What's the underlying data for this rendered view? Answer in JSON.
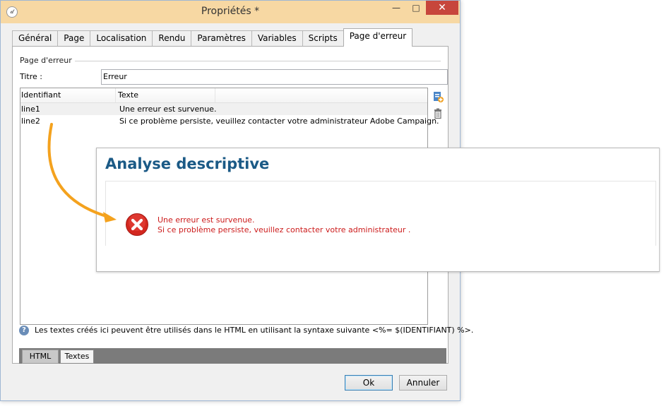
{
  "window": {
    "title": "Propriétés *",
    "app_icon": "𝒹"
  },
  "tabs": [
    "Général",
    "Page",
    "Localisation",
    "Rendu",
    "Paramètres",
    "Variables",
    "Scripts",
    "Page d'erreur"
  ],
  "section": {
    "title": "Page d'erreur"
  },
  "form": {
    "titre_label": "Titre :",
    "titre_value": "Erreur"
  },
  "grid": {
    "headers": [
      "Identifiant",
      "Texte"
    ],
    "rows": [
      {
        "id": "line1",
        "text": "Une erreur est survenue."
      },
      {
        "id": "line2",
        "text": "Si ce problème persiste, veuillez contacter votre administrateur Adobe Campaign."
      }
    ]
  },
  "hint": "Les textes créés ici peuvent être utilisés dans le HTML en utilisant la syntaxe suivante <%= $(IDENTIFIANT) %>.",
  "bottom_tabs": {
    "html": "HTML",
    "textes": "Textes"
  },
  "buttons": {
    "ok": "Ok",
    "cancel": "Annuler"
  },
  "overlay": {
    "title": "Analyse descriptive",
    "line1": "Une erreur est survenue.",
    "line2": "Si ce problème persiste, veuillez contacter votre administrateur ."
  },
  "colors": {
    "overlay_title": "#1b5a86",
    "error_text": "#cc1b1b",
    "arrow": "#f4a21e",
    "titlebar": "#f7d8a3"
  },
  "icons": {
    "add": "add-text-icon",
    "delete": "trash-icon",
    "help": "help-icon",
    "error": "error-x-icon"
  }
}
